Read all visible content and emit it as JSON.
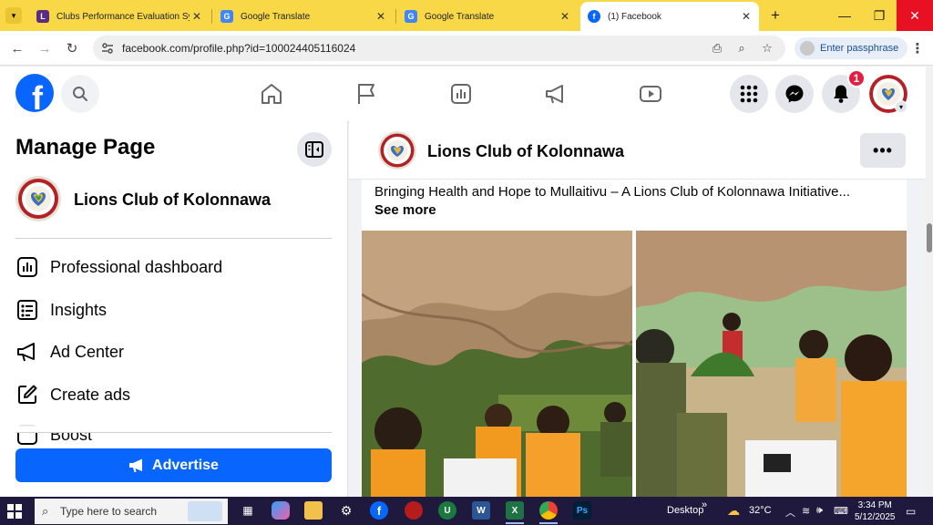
{
  "browser": {
    "tabs": [
      {
        "title": "Clubs Performance Evaluation Syst",
        "icon": "lions-logo-icon"
      },
      {
        "title": "Google Translate",
        "icon": "google-translate-icon"
      },
      {
        "title": "Google Translate",
        "icon": "google-translate-icon"
      },
      {
        "title": "(1) Facebook",
        "icon": "facebook-icon",
        "active": true
      }
    ],
    "new_tab": "+",
    "url": "facebook.com/profile.php?id=100024405116024",
    "passphrase_button": "Enter passphrase",
    "accent_color": "#f8d847"
  },
  "facebook": {
    "logo_letter": "f",
    "brand_color": "#0866ff",
    "notification_count": "1"
  },
  "sidebar": {
    "title": "Manage Page",
    "page_name": "Lions Club of Kolonnawa",
    "items": [
      {
        "label": "Professional dashboard",
        "icon": "dashboard-icon"
      },
      {
        "label": "Insights",
        "icon": "insights-icon"
      },
      {
        "label": "Ad Center",
        "icon": "megaphone-icon"
      },
      {
        "label": "Create ads",
        "icon": "pencil-square-icon"
      },
      {
        "label": "Boost",
        "icon": "boost-icon"
      }
    ],
    "advertise_label": "Advertise"
  },
  "post": {
    "author": "Lions Club of Kolonnawa",
    "more_label": "•••",
    "text": "Bringing Health and Hope to Mullaitivu – A Lions Club of Kolonnawa Initiative...",
    "see_more": "See more"
  },
  "taskbar": {
    "search_placeholder": "Type here to search",
    "desktop_label": "Desktop",
    "temperature": "32°C",
    "time": "3:34 PM",
    "date": "5/12/2025"
  }
}
